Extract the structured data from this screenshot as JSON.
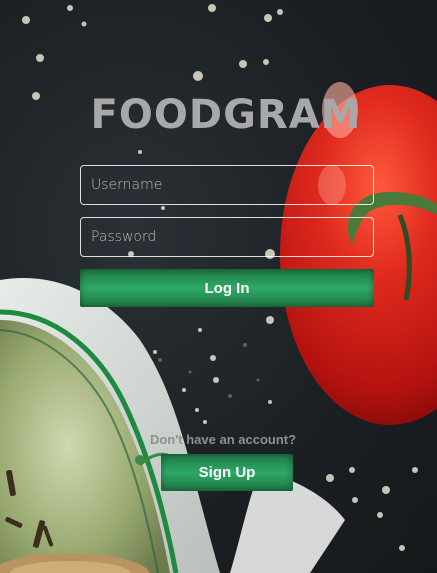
{
  "app": {
    "logo_text": "FOODGRAM"
  },
  "login_form": {
    "username_placeholder": "Username",
    "password_placeholder": "Password",
    "login_button_label": "Log In"
  },
  "signup": {
    "prompt_text": "Don't have an account?",
    "signup_button_label": "Sign Up"
  },
  "colors": {
    "button_green": "#2a9a5c",
    "tomato_red": "#d8241c",
    "logo_gray": "#a8a8a8"
  }
}
